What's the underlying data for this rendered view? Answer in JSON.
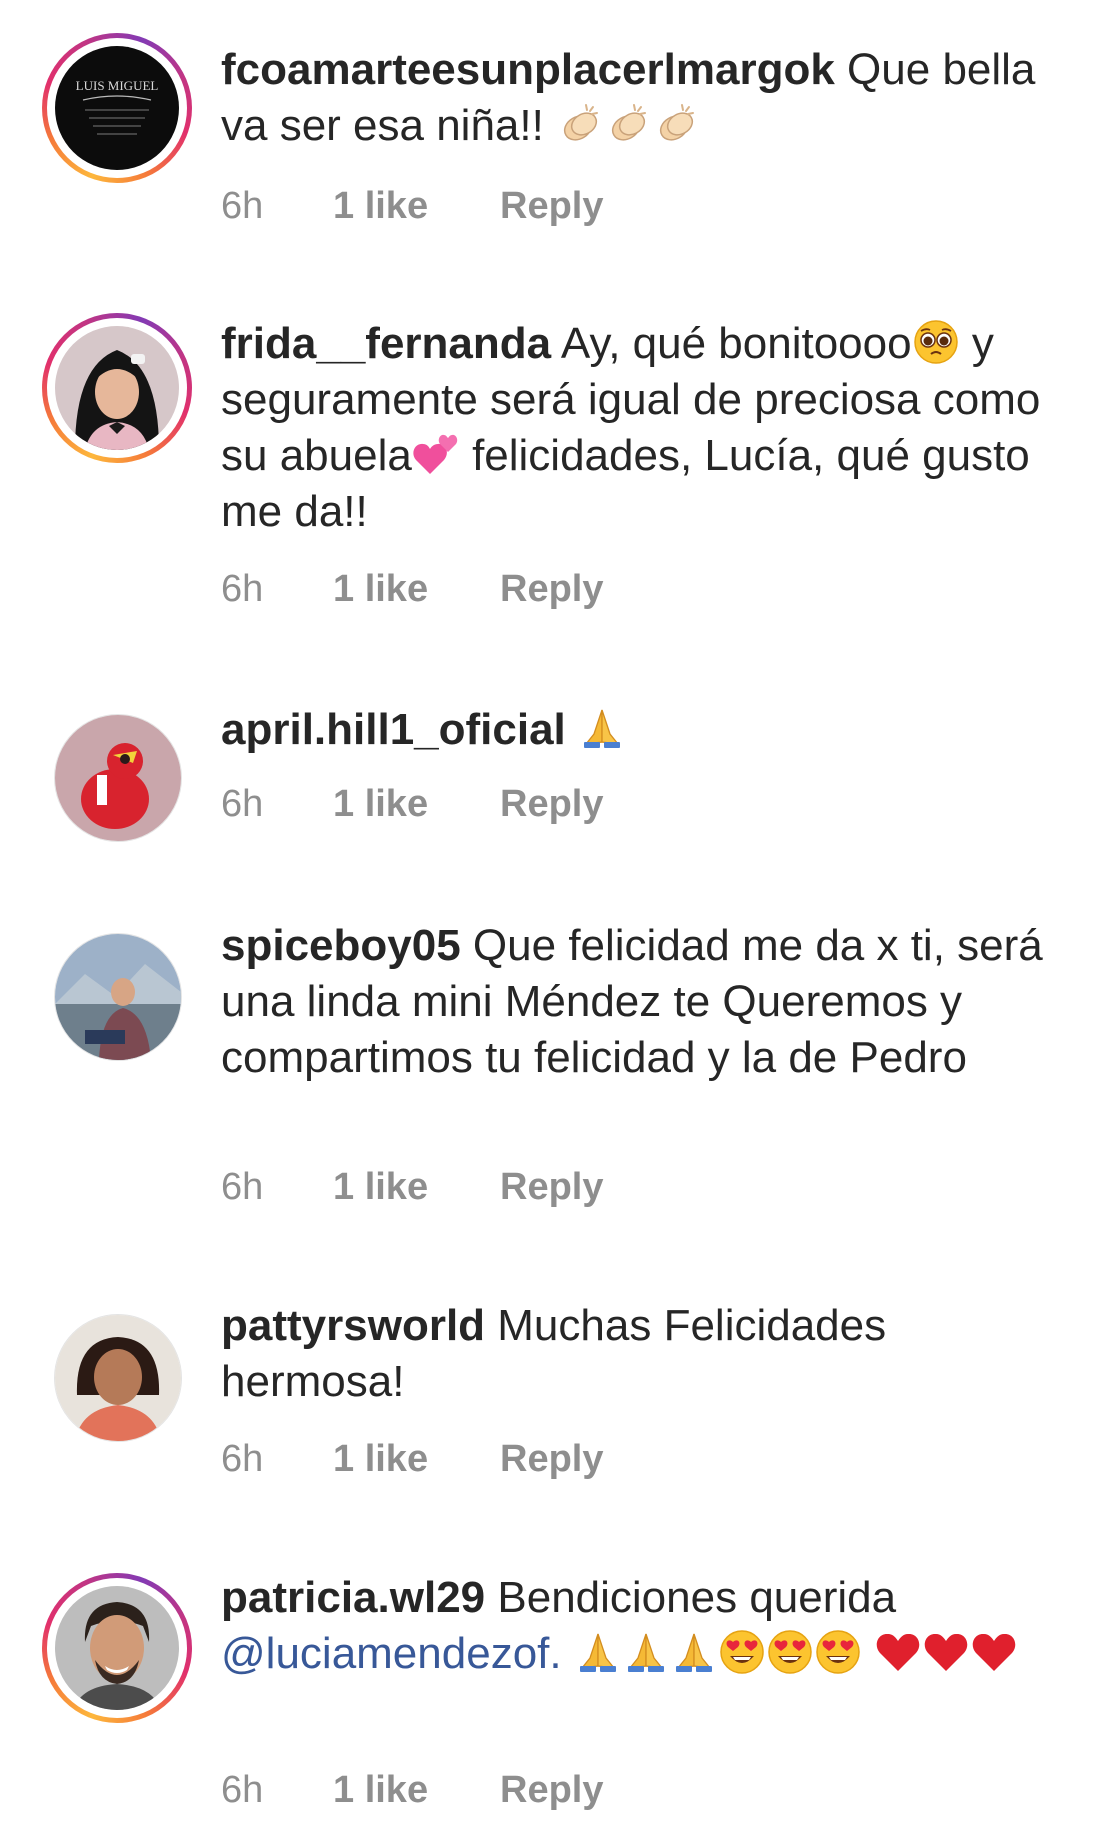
{
  "comments": [
    {
      "username": "fcoamarteesunplacerlmargok",
      "text_1": "Que bella va ser esa niña!!",
      "emoji_names": [
        "clapping-hands",
        "clapping-hands",
        "clapping-hands"
      ],
      "avatar_text": [
        "LUIS MIGUEL"
      ],
      "time": "6h",
      "likes": "1 like",
      "reply": "Reply"
    },
    {
      "username": "frida__fernanda",
      "text_1": "Ay, qué bonitoooo",
      "text_2": "y seguramente será igual de preciosa como su abuela",
      "text_3": "felicidades, Lucía, qué gusto me da!!",
      "emoji_names": [
        "pleading-face",
        "two-hearts"
      ],
      "time": "6h",
      "likes": "1 like",
      "reply": "Reply"
    },
    {
      "username": "april.hill1_oficial",
      "emoji_names": [
        "folded-hands"
      ],
      "time": "6h",
      "likes": "1 like",
      "reply": "Reply"
    },
    {
      "username": "spiceboy05",
      "text_1": "Que felicidad me da x ti, será una linda mini Méndez te Queremos y compartimos tu felicidad y la de Pedro",
      "time": "6h",
      "likes": "1 like",
      "reply": "Reply"
    },
    {
      "username": "pattyrsworld",
      "text_1": "Muchas Felicidades hermosa!",
      "time": "6h",
      "likes": "1 like",
      "reply": "Reply"
    },
    {
      "username": "patricia.wl29",
      "text_1": "Bendiciones querida",
      "mention": "@luciamendezof.",
      "emoji_names": [
        "folded-hands",
        "folded-hands",
        "folded-hands",
        "heart-eyes",
        "heart-eyes",
        "heart-eyes",
        "red-heart",
        "red-heart",
        "red-heart"
      ],
      "time": "6h",
      "likes": "1 like",
      "reply": "Reply"
    }
  ],
  "colors": {
    "text": "#262626",
    "meta": "#8e8e8e",
    "mention": "#385898",
    "background": "#ffffff"
  }
}
